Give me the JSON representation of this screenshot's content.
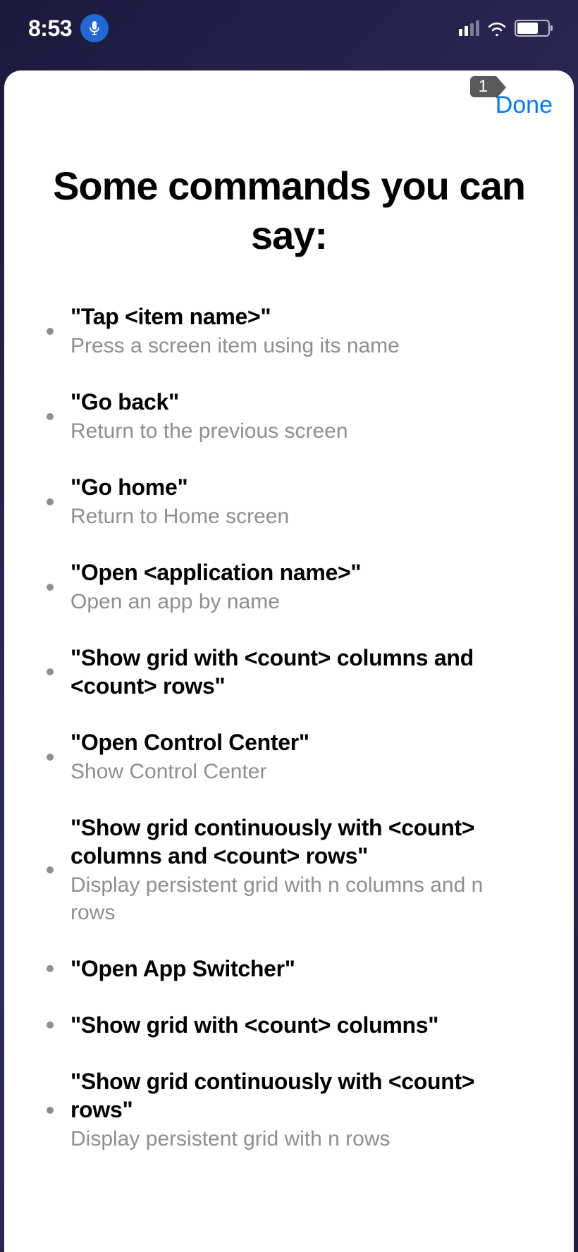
{
  "statusBar": {
    "time": "8:53"
  },
  "badge": {
    "number": "1"
  },
  "header": {
    "doneLabel": "Done"
  },
  "page": {
    "title": "Some commands you can say:"
  },
  "commands": [
    {
      "title": "\"Tap <item name>\"",
      "desc": "Press a screen item using its name"
    },
    {
      "title": "\"Go back\"",
      "desc": "Return to the previous screen"
    },
    {
      "title": "\"Go home\"",
      "desc": "Return to Home screen"
    },
    {
      "title": "\"Open <application name>\"",
      "desc": "Open an app by name"
    },
    {
      "title": "\"Show grid with <count> columns and <count> rows\"",
      "desc": ""
    },
    {
      "title": "\"Open Control Center\"",
      "desc": "Show Control Center"
    },
    {
      "title": "\"Show grid continuously with <count> columns and <count> rows\"",
      "desc": "Display persistent grid with n columns and n rows"
    },
    {
      "title": "\"Open App Switcher\"",
      "desc": ""
    },
    {
      "title": "\"Show grid with <count> columns\"",
      "desc": ""
    },
    {
      "title": "\"Show grid continuously with <count> rows\"",
      "desc": "Display persistent grid with n rows"
    }
  ]
}
